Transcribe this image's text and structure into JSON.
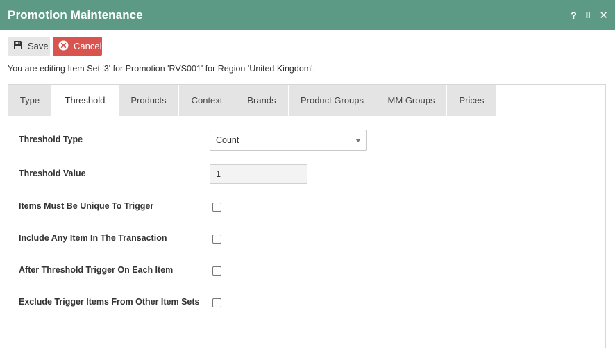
{
  "window": {
    "title": "Promotion Maintenance",
    "help_label": "?",
    "pause_label": "II",
    "close_label": "✕"
  },
  "toolbar": {
    "save_label": "Save",
    "cancel_label": "Cancel"
  },
  "info_text": "You are editing Item Set '3' for Promotion 'RVS001' for Region 'United Kingdom'.",
  "tabs": [
    {
      "label": "Type"
    },
    {
      "label": "Threshold",
      "active": true
    },
    {
      "label": "Products"
    },
    {
      "label": "Context"
    },
    {
      "label": "Brands"
    },
    {
      "label": "Product Groups"
    },
    {
      "label": "MM Groups"
    },
    {
      "label": "Prices"
    }
  ],
  "form": {
    "threshold_type": {
      "label": "Threshold Type",
      "value": "Count"
    },
    "threshold_value": {
      "label": "Threshold Value",
      "value": "1"
    },
    "unique_to_trigger": {
      "label": "Items Must Be Unique To Trigger",
      "checked": false
    },
    "include_any_item": {
      "label": "Include Any Item In The Transaction",
      "checked": false
    },
    "after_threshold_each": {
      "label": "After Threshold Trigger On Each Item",
      "checked": false
    },
    "exclude_trigger_items": {
      "label": "Exclude Trigger Items From Other Item Sets",
      "checked": false
    }
  },
  "colors": {
    "titlebar": "#5c9a86",
    "cancel": "#d9534f",
    "tab_inactive": "#e4e4e4"
  }
}
